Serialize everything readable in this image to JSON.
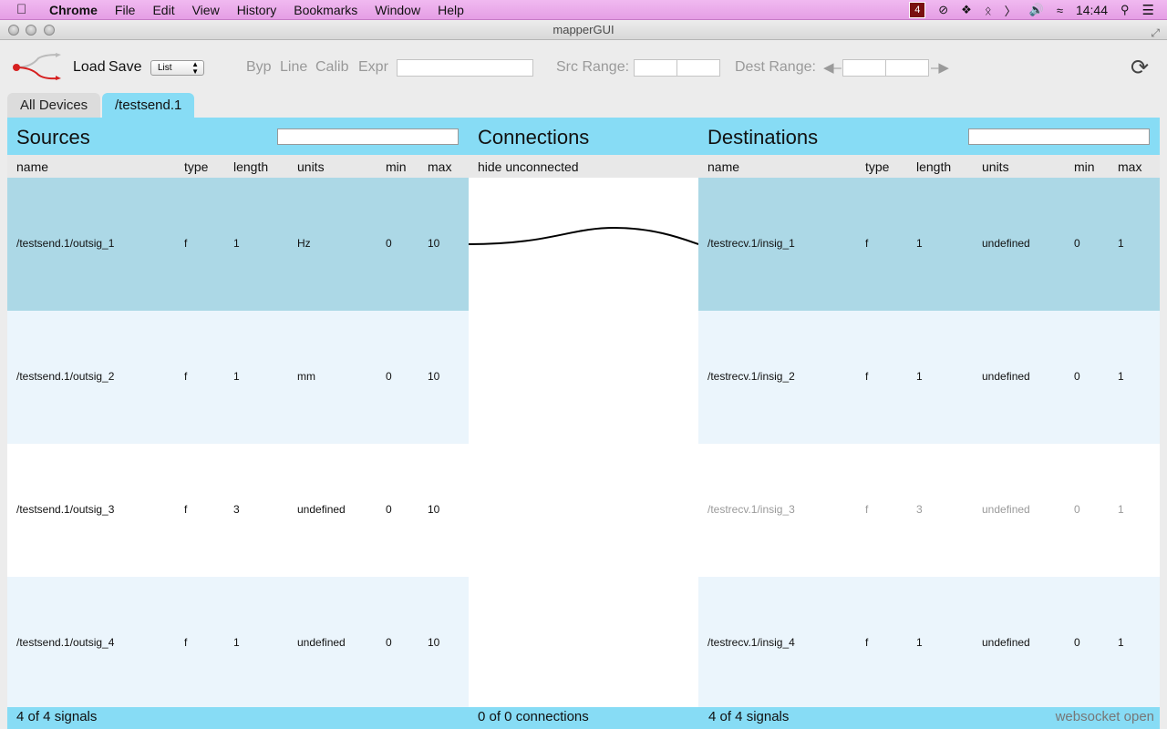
{
  "menubar": {
    "app": "Chrome",
    "items": [
      "File",
      "Edit",
      "View",
      "History",
      "Bookmarks",
      "Window",
      "Help"
    ],
    "badge": "4",
    "clock": "14:44"
  },
  "window": {
    "title": "mapperGUI"
  },
  "toolbar": {
    "load": "Load",
    "save": "Save",
    "view_select": "List",
    "modes": [
      "Byp",
      "Line",
      "Calib",
      "Expr"
    ],
    "src_range_label": "Src Range:",
    "dest_range_label": "Dest Range:"
  },
  "tabs": [
    "All Devices",
    "/testsend.1"
  ],
  "sections": {
    "sources": "Sources",
    "connections": "Connections",
    "destinations": "Destinations"
  },
  "columns": {
    "sources": [
      "name",
      "type",
      "length",
      "units",
      "min",
      "max"
    ],
    "connections": "hide unconnected",
    "destinations": [
      "name",
      "type",
      "length",
      "units",
      "min",
      "max"
    ]
  },
  "sources": [
    [
      "/testsend.1/outsig_1",
      "f",
      "1",
      "Hz",
      "0",
      "10"
    ],
    [
      "/testsend.1/outsig_2",
      "f",
      "1",
      "mm",
      "0",
      "10"
    ],
    [
      "/testsend.1/outsig_3",
      "f",
      "3",
      "undefined",
      "0",
      "10"
    ],
    [
      "/testsend.1/outsig_4",
      "f",
      "1",
      "undefined",
      "0",
      "10"
    ]
  ],
  "destinations": [
    [
      "/testrecv.1/insig_1",
      "f",
      "1",
      "undefined",
      "0",
      "1"
    ],
    [
      "/testrecv.1/insig_2",
      "f",
      "1",
      "undefined",
      "0",
      "1"
    ],
    [
      "/testrecv.1/insig_3",
      "f",
      "3",
      "undefined",
      "0",
      "1"
    ],
    [
      "/testrecv.1/insig_4",
      "f",
      "1",
      "undefined",
      "0",
      "1"
    ]
  ],
  "footer": {
    "src_count": "4 of 4 signals",
    "conn_count": "0 of 0 connections",
    "dst_count": "4 of 4 signals",
    "status": "websocket open"
  },
  "colors": {
    "accent": "#87dcf5",
    "row_selected": "#acd8e6",
    "row_alt": "#ebf5fc",
    "row_plain": "#ffffff"
  }
}
